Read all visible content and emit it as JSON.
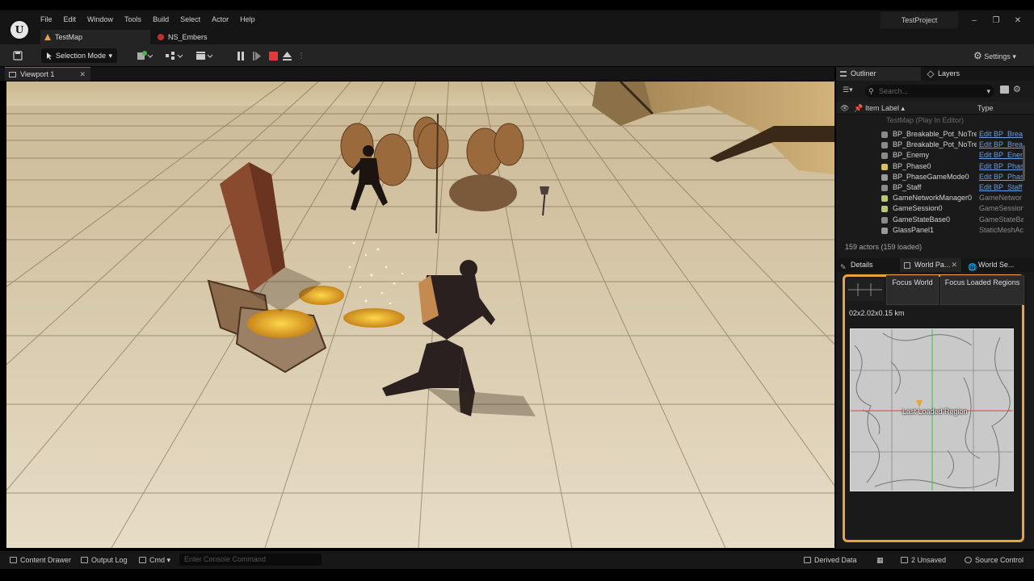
{
  "menu": [
    "File",
    "Edit",
    "Window",
    "Tools",
    "Build",
    "Select",
    "Actor",
    "Help"
  ],
  "project_name": "TestProject",
  "level_tabs": [
    {
      "label": "TestMap",
      "active": true
    },
    {
      "label": "NS_Embers",
      "active": false
    }
  ],
  "toolbar": {
    "selection_mode": "Selection Mode",
    "settings": "Settings"
  },
  "viewport": {
    "tab_label": "Viewport 1"
  },
  "outliner": {
    "tabs": [
      "Outliner",
      "Layers"
    ],
    "search_placeholder": "Search...",
    "columns": {
      "label": "Item Label ▴",
      "type": "Type"
    },
    "map_row": "TestMap (Play In Editor)",
    "rows": [
      {
        "label": "BP_Breakable_Pot_NoTrea",
        "type": "Edit BP_Brea",
        "link": true,
        "icon": "#8a8a8a"
      },
      {
        "label": "BP_Breakable_Pot_NoTrea",
        "type": "Edit BP_Brea",
        "link": true,
        "icon": "#8a8a8a"
      },
      {
        "label": "BP_Enemy",
        "type": "Edit BP_Enen",
        "link": true,
        "icon": "#8a8a8a"
      },
      {
        "label": "BP_Phase0",
        "type": "Edit BP_Phas",
        "link": true,
        "icon": "#d6c15a"
      },
      {
        "label": "BP_PhaseGameMode0",
        "type": "Edit BP_Phas",
        "link": true,
        "icon": "#9a9a9a"
      },
      {
        "label": "BP_Staff",
        "type": "Edit BP_Staff",
        "link": true,
        "icon": "#8a8a8a"
      },
      {
        "label": "GameNetworkManager0",
        "type": "GameNetwor",
        "link": false,
        "icon": "#b8c870"
      },
      {
        "label": "GameSession0",
        "type": "GameSession",
        "link": false,
        "icon": "#b8c870"
      },
      {
        "label": "GameStateBase0",
        "type": "GameStateBa",
        "link": false,
        "icon": "#8a8a8a"
      },
      {
        "label": "GlassPanel1",
        "type": "StaticMeshAc",
        "link": false,
        "icon": "#9a9a9a"
      }
    ],
    "count": "159 actors (159 loaded)"
  },
  "details": {
    "tabs": [
      "Details",
      "World Pa...",
      "World Se..."
    ],
    "focus_world": "Focus World",
    "focus_loaded": "Focus Loaded Regions",
    "world_size": "02x2.02x0.15 km",
    "region_label": "Last Loaded Region"
  },
  "statusbar": {
    "content_drawer": "Content Drawer",
    "output_log": "Output Log",
    "cmd": "Cmd",
    "console_placeholder": "Enter Console Command",
    "derived_data": "Derived Data",
    "unsaved": "2 Unsaved",
    "source_control": "Source Control"
  },
  "colors": {
    "accent": "#3a7bd5",
    "highlight": "#e8a33a",
    "stop": "#e03a3a"
  }
}
